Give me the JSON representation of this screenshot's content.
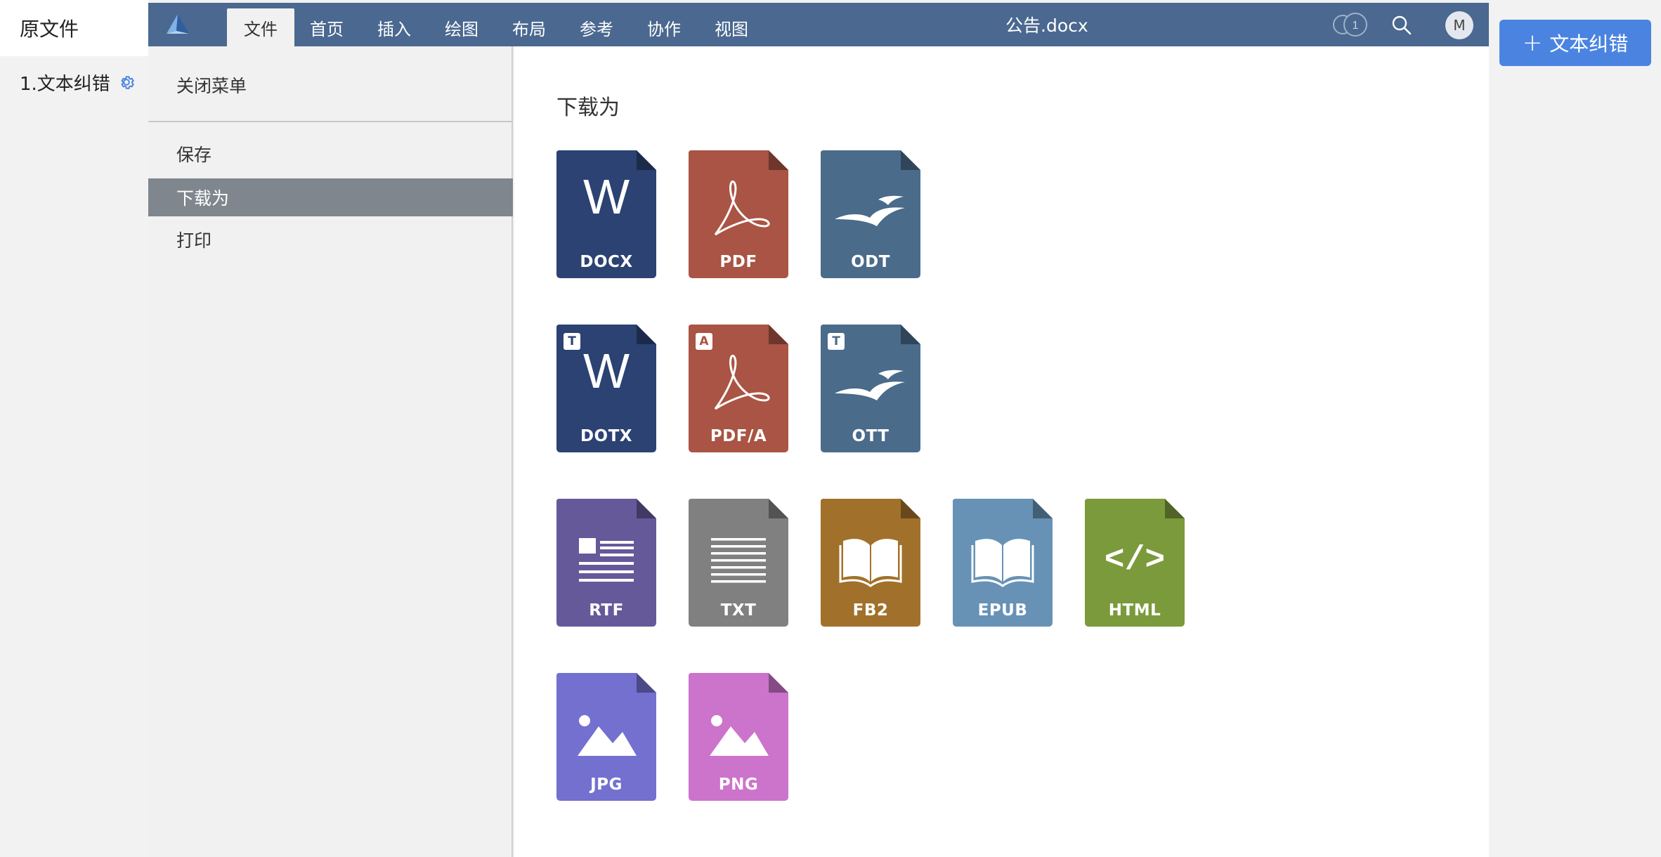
{
  "left_sidebar": {
    "header": "原文件",
    "items": [
      {
        "label": "1.文本纠错",
        "icon": "gear-icon"
      }
    ]
  },
  "topbar": {
    "logo_icon": "app-logo-icon",
    "tabs": [
      "文件",
      "首页",
      "插入",
      "绘图",
      "布局",
      "参考",
      "协作",
      "视图"
    ],
    "active_tab": "文件",
    "document_title": "公告.docx",
    "users_count": "1",
    "avatar_letter": "M"
  },
  "file_menu": {
    "close_label": "关闭菜单",
    "items": [
      "保存",
      "下载为",
      "打印"
    ],
    "active_item": "下载为"
  },
  "download_panel": {
    "title": "下载为",
    "formats": [
      {
        "label": "DOCX",
        "color": "#2b4272",
        "glyph": "W"
      },
      {
        "label": "PDF",
        "color": "#a95444",
        "glyph": "pdf-icon"
      },
      {
        "label": "ODT",
        "color": "#4a6b8a",
        "glyph": "seagull-icon"
      },
      {
        "label": "DOTX",
        "color": "#2b4272",
        "glyph": "W",
        "badge": "T"
      },
      {
        "label": "PDF/A",
        "color": "#a95444",
        "glyph": "pdf-icon",
        "badge": "A"
      },
      {
        "label": "OTT",
        "color": "#4a6b8a",
        "glyph": "seagull-icon",
        "badge": "T"
      },
      {
        "label": "RTF",
        "color": "#66599a",
        "glyph": "rtf-lines-icon"
      },
      {
        "label": "TXT",
        "color": "#808080",
        "glyph": "txt-lines-icon"
      },
      {
        "label": "FB2",
        "color": "#a1712b",
        "glyph": "book-icon"
      },
      {
        "label": "EPUB",
        "color": "#6792b5",
        "glyph": "book-icon"
      },
      {
        "label": "HTML",
        "color": "#7b9a3c",
        "glyph": "code-icon"
      },
      {
        "label": "JPG",
        "color": "#7470d0",
        "glyph": "image-icon"
      },
      {
        "label": "PNG",
        "color": "#cc73cc",
        "glyph": "image-icon"
      }
    ]
  },
  "right_area": {
    "add_button_label": "文本纠错"
  }
}
